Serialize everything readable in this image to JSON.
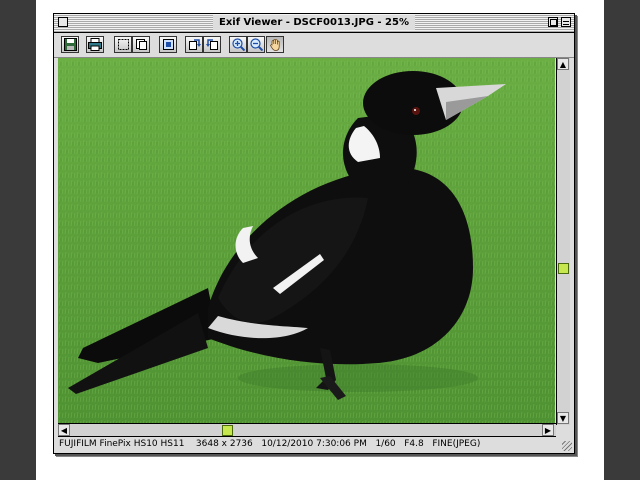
{
  "window": {
    "title": "Exif Viewer - DSCF0013.JPG - 25%"
  },
  "toolbar": {
    "buttons": [
      {
        "name": "save",
        "icon": "floppy-disk-icon"
      },
      {
        "name": "print",
        "icon": "printer-icon"
      },
      {
        "name": "select-rect",
        "icon": "marquee-icon"
      },
      {
        "name": "copy",
        "icon": "copy-icon"
      },
      {
        "name": "crop",
        "icon": "crop-icon"
      },
      {
        "name": "rotate-right",
        "icon": "rotate-right-icon"
      },
      {
        "name": "rotate-left",
        "icon": "rotate-left-icon"
      },
      {
        "name": "zoom-in",
        "icon": "zoom-in-icon"
      },
      {
        "name": "zoom-out",
        "icon": "zoom-out-icon"
      },
      {
        "name": "hand-tool",
        "icon": "hand-icon",
        "active": true
      }
    ]
  },
  "status": {
    "camera": "FUJIFILM FinePix HS10 HS11",
    "dimensions": "3648 x 2736",
    "datetime": "10/12/2010 7:30:06 PM",
    "shutter": "1/60",
    "aperture": "F4.8",
    "quality": "FINE(JPEG)"
  },
  "scroll": {
    "horizontal_position": 0.33,
    "vertical_position": 0.6
  },
  "colors": {
    "accent_thumb": "#c6e84e",
    "grass": "#5fa33e"
  }
}
